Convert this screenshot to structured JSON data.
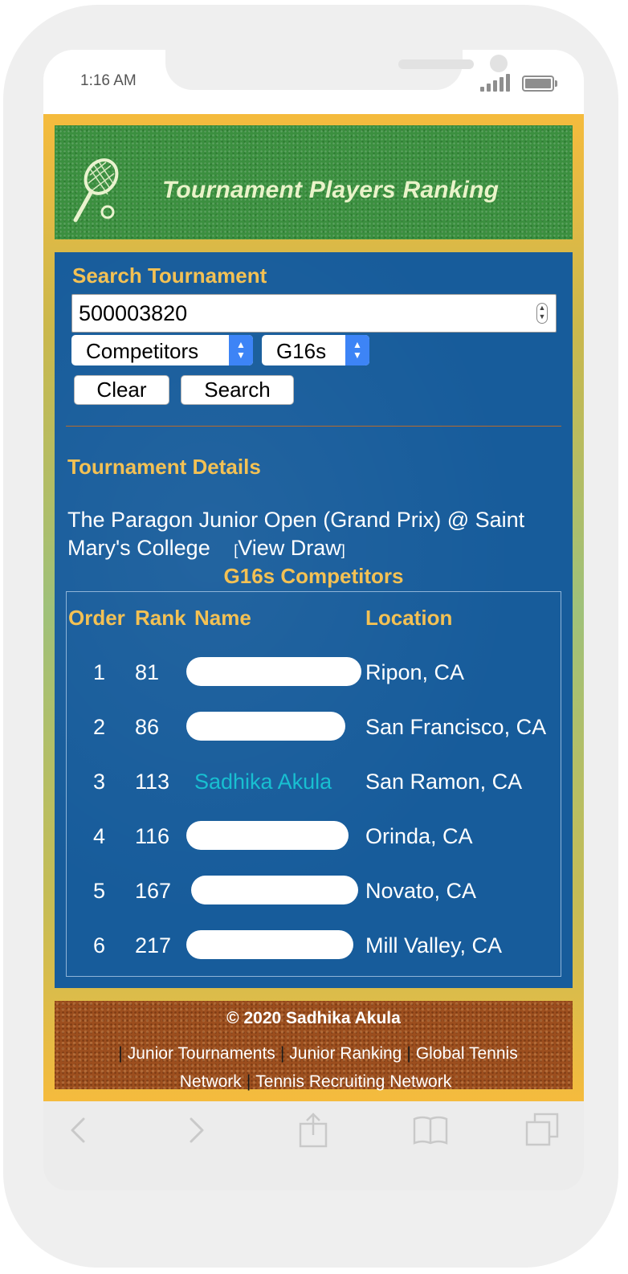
{
  "status_bar": {
    "time": "1:16 AM"
  },
  "header": {
    "title": "Tournament Players Ranking"
  },
  "search": {
    "label": "Search Tournament",
    "tournament_id": "500003820",
    "type_select": "Competitors",
    "division_select": "G16s",
    "clear_label": "Clear",
    "search_label": "Search"
  },
  "details": {
    "label": "Tournament Details",
    "tournament_name": "The Paragon Junior Open (Grand Prix) @ Saint Mary's College",
    "view_draw_label": "View Draw",
    "bracket_open": "[",
    "bracket_close": "]"
  },
  "competitors": {
    "title": "G16s Competitors",
    "headers": {
      "order": "Order",
      "rank": "Rank",
      "name": "Name",
      "location": "Location"
    },
    "rows": [
      {
        "order": "1",
        "rank": "81",
        "name": "",
        "location": "Ripon, CA",
        "redacted": true
      },
      {
        "order": "2",
        "rank": "86",
        "name": "",
        "location": "San Francisco, CA",
        "redacted": true
      },
      {
        "order": "3",
        "rank": "113",
        "name": "Sadhika Akula",
        "location": "San Ramon, CA",
        "redacted": false
      },
      {
        "order": "4",
        "rank": "116",
        "name": "",
        "location": "Orinda, CA",
        "redacted": true
      },
      {
        "order": "5",
        "rank": "167",
        "name": "",
        "location": "Novato, CA",
        "redacted": true
      },
      {
        "order": "6",
        "rank": "217",
        "name": "",
        "location": "Mill Valley, CA",
        "redacted": true
      }
    ]
  },
  "footer": {
    "copyright": "© 2020 Sadhika Akula",
    "separator": "|",
    "links": [
      "Junior Tournaments",
      "Junior Ranking",
      "Global Tennis Network",
      "Tennis Recruiting Network"
    ]
  },
  "icons": {
    "banner": "tennis-racket-icon",
    "toolbar": [
      "back-icon",
      "forward-icon",
      "share-icon",
      "bookmarks-icon",
      "tabs-icon"
    ]
  },
  "colors": {
    "panel_blue": "#175c9b",
    "heading_gold": "#f3c154",
    "name_highlight": "#18bfd1",
    "select_accent": "#3d84f6",
    "page_frame": "#f5bb3d"
  }
}
